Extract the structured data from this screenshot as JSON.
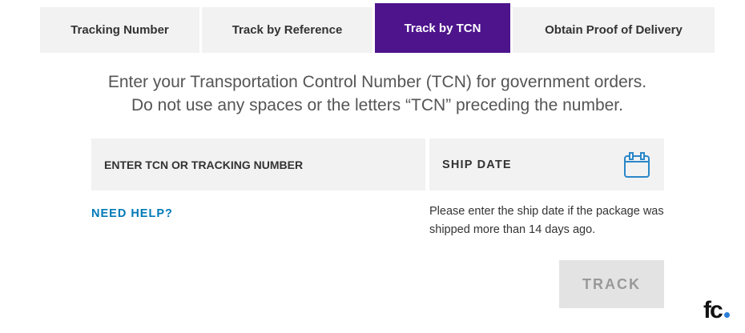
{
  "tabs": [
    {
      "label": "Tracking Number",
      "active": false
    },
    {
      "label": "Track by Reference",
      "active": false
    },
    {
      "label": "Track by TCN",
      "active": true
    },
    {
      "label": "Obtain Proof of Delivery",
      "active": false
    }
  ],
  "intro": {
    "line1": "Enter your Transportation Control Number (TCN) for government orders.",
    "line2": "Do not use any spaces or the letters “TCN” preceding the number."
  },
  "form": {
    "tcn_label": "ENTER TCN OR TRACKING NUMBER",
    "ship_date_label": "SHIP DATE",
    "ship_date_icon": "calendar-icon",
    "help_link": "NEED HELP?",
    "ship_date_hint": "Please enter the ship date if the package was shipped more than 14 days ago.",
    "track_button": "TRACK"
  },
  "logo": {
    "text": "fc",
    "dot_color": "#2a7fd6"
  },
  "colors": {
    "accent": "#4d148c",
    "link": "#007ab7",
    "field_bg": "#f2f2f2"
  }
}
